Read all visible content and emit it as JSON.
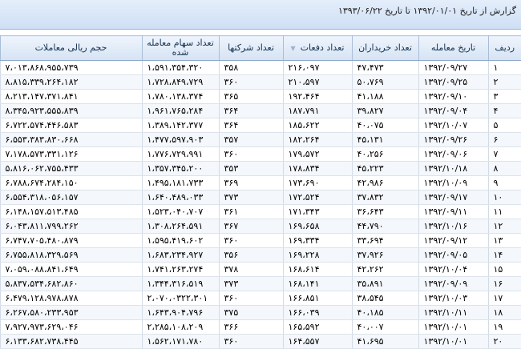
{
  "report": {
    "title": "گزارش از تاریخ ۱۳۹۲/۰۱/۰۱ تا تاریخ ۱۳۹۳/۰۶/۲۲"
  },
  "columns": {
    "row_no": "ردیف",
    "trade_date": "تاریخ معامله",
    "buyers": "تعداد خریداران",
    "trades": "تعداد دفعات",
    "companies": "تعداد شرکتها",
    "shares": "تعداد سهام معامله شده",
    "value": "حجم ریالی معاملات"
  },
  "rows": [
    {
      "row_no": "۱",
      "trade_date": "۱۳۹۲/۰۹/۲۷",
      "buyers": "۴۷،۴۷۳",
      "trades": "۲۱۶،۰۹۷",
      "companies": "۳۵۸",
      "shares": "۱،۵۹۱،۳۵۴،۳۲۰",
      "value": "۷،۰۱۳،۸۶۸،۹۵۵،۷۳۹"
    },
    {
      "row_no": "۲",
      "trade_date": "۱۳۹۲/۰۹/۲۵",
      "buyers": "۵۰،۷۶۹",
      "trades": "۲۱۰،۵۹۷",
      "companies": "۳۶۰",
      "shares": "۱،۷۲۸،۸۴۹،۷۲۹",
      "value": "۸،۸۱۵،۳۳۹،۲۶۴،۱۸۲"
    },
    {
      "row_no": "۳",
      "trade_date": "۱۳۹۲/۰۹/۱۰",
      "buyers": "۴۱،۱۸۸",
      "trades": "۱۹۲،۴۶۴",
      "companies": "۳۶۵",
      "shares": "۱،۷۸۰،۱۳۸،۳۷۴",
      "value": "۸،۲۱۳،۱۴۷،۳۷۱،۸۴۱"
    },
    {
      "row_no": "۴",
      "trade_date": "۱۳۹۲/۰۹/۰۴",
      "buyers": "۳۹،۸۲۷",
      "trades": "۱۸۷،۷۹۱",
      "companies": "۳۶۴",
      "shares": "۱،۹۶۱،۷۶۵،۲۸۴",
      "value": "۸،۳۴۵،۹۲۳،۵۵۵،۸۳۹"
    },
    {
      "row_no": "۵",
      "trade_date": "۱۳۹۲/۱۰/۰۷",
      "buyers": "۴۰،۰۷۵",
      "trades": "۱۸۵،۶۲۲",
      "companies": "۳۶۴",
      "shares": "۱،۳۸۹،۱۴۲،۳۷۷",
      "value": "۶،۷۲۲،۵۷۴،۴۴۶،۵۸۳"
    },
    {
      "row_no": "۶",
      "trade_date": "۱۳۹۲/۰۹/۲۶",
      "buyers": "۴۵،۱۳۱",
      "trades": "۱۸۲،۲۶۴",
      "companies": "۳۵۷",
      "shares": "۱،۴۷۷،۵۹۷،۹۰۳",
      "value": "۶،۵۵۳،۳۸۳،۸۳۰،۶۶۸"
    },
    {
      "row_no": "۷",
      "trade_date": "۱۳۹۲/۰۹/۰۶",
      "buyers": "۴۰،۲۵۶",
      "trades": "۱۷۹،۵۷۲",
      "companies": "۳۶۰",
      "shares": "۱،۷۷۶،۷۲۹،۹۹۱",
      "value": "۷،۱۷۸،۵۷۳،۳۳۱،۱۲۶"
    },
    {
      "row_no": "۸",
      "trade_date": "۱۳۹۲/۱۰/۱۸",
      "buyers": "۴۵،۲۲۳",
      "trades": "۱۷۸،۸۳۴",
      "companies": "۳۵۳",
      "shares": "۱،۳۵۷،۳۴۵،۲۰۰",
      "value": "۵،۸۱۶،۰۶۲،۷۵۵،۴۳۳"
    },
    {
      "row_no": "۹",
      "trade_date": "۱۳۹۲/۱۰/۰۹",
      "buyers": "۴۲،۹۸۶",
      "trades": "۱۷۳،۶۹۰",
      "companies": "۳۶۹",
      "shares": "۱،۴۹۵،۱۸۱،۷۳۳",
      "value": "۶،۷۸۸،۶۷۴،۲۸۴،۱۵۰"
    },
    {
      "row_no": "۱۰",
      "trade_date": "۱۳۹۲/۰۹/۱۷",
      "buyers": "۳۷،۸۳۲",
      "trades": "۱۷۲،۵۲۴",
      "companies": "۳۷۳",
      "shares": "۱،۶۴۰،۴۸۹،۰۳۳",
      "value": "۶،۵۵۴،۳۱۸،۰۵۶،۱۵۷"
    },
    {
      "row_no": "۱۱",
      "trade_date": "۱۳۹۲/۰۹/۱۱",
      "buyers": "۳۶،۶۴۳",
      "trades": "۱۷۱،۳۴۳",
      "companies": "۳۶۱",
      "shares": "۱،۵۲۳،۰۴۰،۷۰۷",
      "value": "۶،۱۴۸،۱۵۷،۵۱۳،۴۸۵"
    },
    {
      "row_no": "۱۲",
      "trade_date": "۱۳۹۲/۱۰/۱۶",
      "buyers": "۴۴،۷۹۰",
      "trades": "۱۶۹،۶۵۸",
      "companies": "۳۶۷",
      "shares": "۱،۳۰۸،۲۶۴،۵۹۱",
      "value": "۶،۰۴۳،۸۱۱،۷۹۹،۲۶۲"
    },
    {
      "row_no": "۱۳",
      "trade_date": "۱۳۹۲/۰۹/۱۲",
      "buyers": "۳۳،۶۹۴",
      "trades": "۱۶۹،۳۳۴",
      "companies": "۳۶۰",
      "shares": "۱،۵۹۵،۴۱۹،۶۰۲",
      "value": "۶،۷۴۷،۷۰۵،۴۸۰،۸۷۹"
    },
    {
      "row_no": "۱۴",
      "trade_date": "۱۳۹۲/۰۹/۰۵",
      "buyers": "۳۷،۹۲۶",
      "trades": "۱۶۹،۲۲۸",
      "companies": "۳۵۶",
      "shares": "۱،۶۸۳،۲۳۴،۹۲۷",
      "value": "۶،۷۵۵،۸۱۸،۳۲۹،۵۶۹"
    },
    {
      "row_no": "۱۵",
      "trade_date": "۱۳۹۲/۱۰/۰۴",
      "buyers": "۴۲،۲۶۲",
      "trades": "۱۶۸،۶۱۴",
      "companies": "۳۷۸",
      "shares": "۱،۷۴۱،۲۶۳،۲۷۴",
      "value": "۷،۰۵۹،۰۸۸،۸۴۱،۶۴۹"
    },
    {
      "row_no": "۱۶",
      "trade_date": "۱۳۹۲/۰۹/۰۹",
      "buyers": "۳۵،۸۹۱",
      "trades": "۱۶۸،۱۴۱",
      "companies": "۳۷۳",
      "shares": "۱،۳۴۴،۳۱۶،۵۱۹",
      "value": "۵،۸۳۷،۵۳۴،۶۸۲،۸۶۰"
    },
    {
      "row_no": "۱۷",
      "trade_date": "۱۳۹۲/۱۰/۰۳",
      "buyers": "۳۸،۵۴۵",
      "trades": "۱۶۶،۸۵۱",
      "companies": "۳۶۰",
      "shares": "۲،۰۷۰،۰۳۲۲،۳۰۱",
      "value": "۶،۴۷۹،۱۲۸،۹۷۸،۸۷۸"
    },
    {
      "row_no": "۱۸",
      "trade_date": "۱۳۹۲/۱۰/۱۱",
      "buyers": "۴۰،۱۸۵",
      "trades": "۱۶۶،۰۳۹",
      "companies": "۳۷۵",
      "shares": "۱،۶۴۳،۹۰۴،۷۹۶",
      "value": "۶،۲۶۷،۵۸۰،۲۳۳،۹۵۳"
    },
    {
      "row_no": "۱۹",
      "trade_date": "۱۳۹۲/۱۰/۰۱",
      "buyers": "۴۰،۰۰۷",
      "trades": "۱۶۵،۵۹۲",
      "companies": "۳۶۶",
      "shares": "۲،۲۸۵،۱۰۸،۲۰۹",
      "value": "۷،۹۲۷،۹۷۳،۶۲۹،۰۴۶"
    },
    {
      "row_no": "۲۰",
      "trade_date": "۱۳۹۲/۱۰/۰۱",
      "buyers": "۴۱،۶۹۵",
      "trades": "۱۶۴،۵۵۷",
      "companies": "۳۶۰",
      "shares": "۱،۵۶۲،۱۷۱،۷۸۰",
      "value": "۶،۱۳۳،۶۸۲،۷۳۸،۴۴۵"
    }
  ]
}
